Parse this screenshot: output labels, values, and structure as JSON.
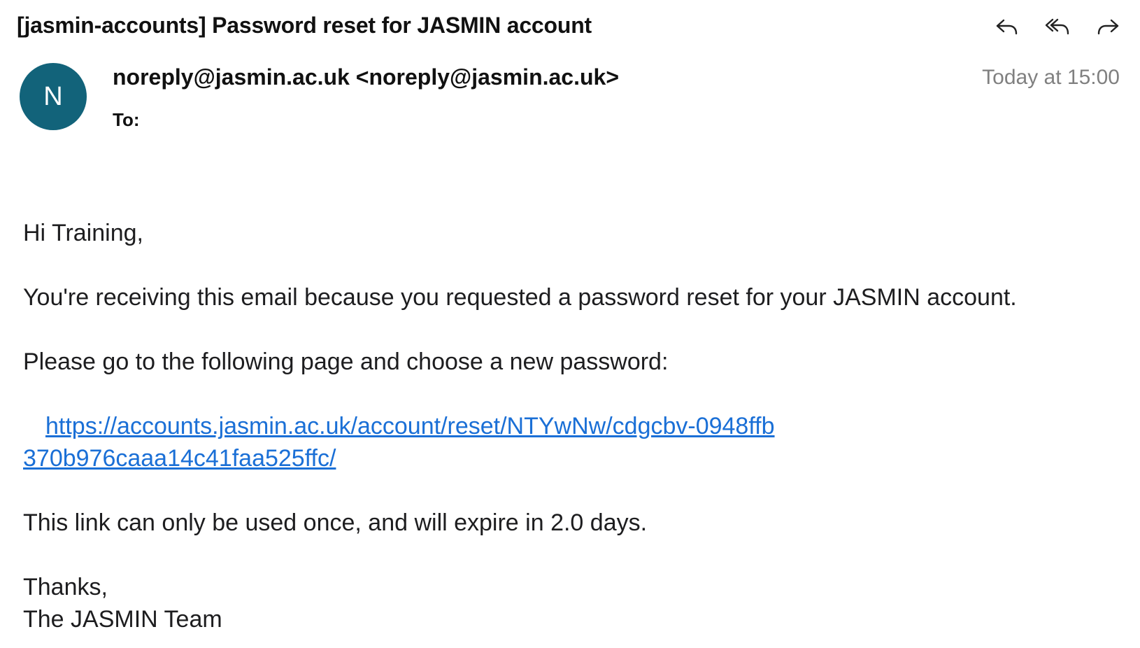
{
  "email": {
    "subject": "[jasmin-accounts] Password reset for JASMIN account",
    "actions": {
      "reply_icon": "reply-icon",
      "reply_all_icon": "reply-all-icon",
      "forward_icon": "forward-icon"
    },
    "sender": {
      "avatar_initial": "N",
      "avatar_color": "#12637a",
      "display": "noreply@jasmin.ac.uk <noreply@jasmin.ac.uk>"
    },
    "to_label": "To:",
    "timestamp": "Today at 15:00",
    "body": {
      "greeting": "Hi Training,",
      "paragraph1": "You're receiving this email because you requested a password reset for your JASMIN account.",
      "paragraph2": "Please go to the following page and choose a new password:",
      "reset_link": "https://accounts.jasmin.ac.uk/account/reset/NTYwNw/cdgcbv-0948ffb370b976caaa14c41faa525ffc/",
      "paragraph3": "This link can only be used once, and will expire in 2.0 days.",
      "signoff": "Thanks,",
      "signature": "The JASMIN Team"
    },
    "colors": {
      "link": "#1a6fd6",
      "timestamp": "#808080"
    }
  }
}
